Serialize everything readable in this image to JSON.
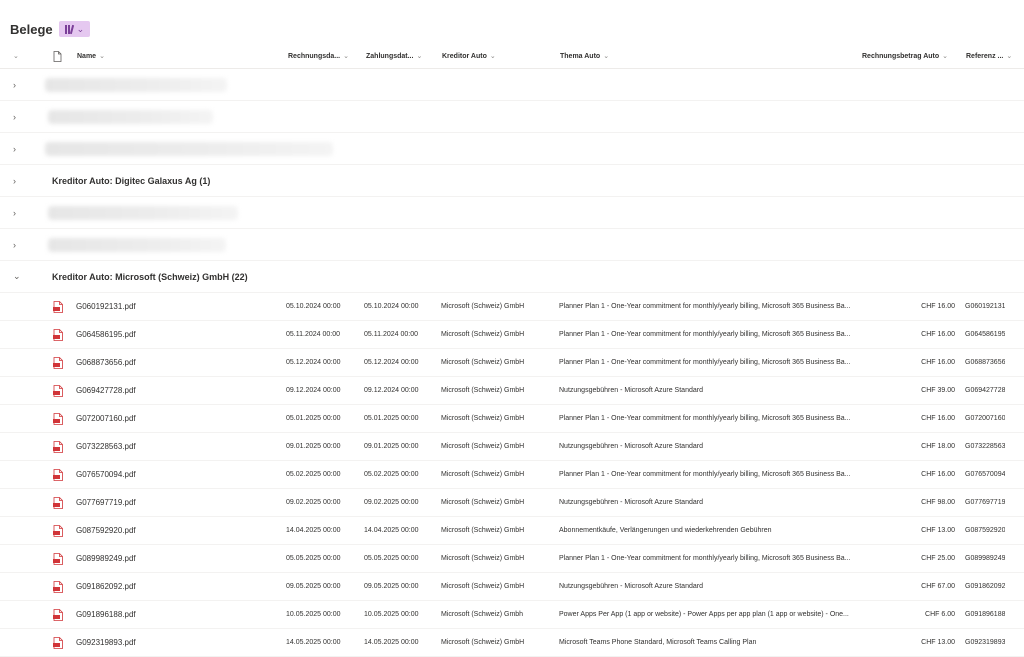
{
  "header": {
    "title": "Belege",
    "view_icon": "library-icon"
  },
  "columns": {
    "name": "Name",
    "rechnungsdatum": "Rechnungsda...",
    "zahlungsdatum": "Zahlungsdat...",
    "kreditor": "Kreditor Auto",
    "thema": "Thema Auto",
    "betrag": "Rechnungsbetrag Auto",
    "referenz": "Referenz ..."
  },
  "groups": {
    "digitec": "Kreditor Auto: Digitec Galaxus Ag (1)",
    "microsoft": "Kreditor Auto: Microsoft (Schweiz) GmbH (22)"
  },
  "files": [
    {
      "name": "G060192131.pdf",
      "rdate": "05.10.2024 00:00",
      "zdate": "05.10.2024 00:00",
      "kreditor": "Microsoft (Schweiz) GmbH",
      "thema": "Planner Plan 1 - One-Year commitment for monthly/yearly billing, Microsoft 365 Business Ba...",
      "betrag": "CHF 16.00",
      "ref": "G060192131"
    },
    {
      "name": "G064586195.pdf",
      "rdate": "05.11.2024 00:00",
      "zdate": "05.11.2024 00:00",
      "kreditor": "Microsoft (Schweiz) GmbH",
      "thema": "Planner Plan 1 - One-Year commitment for monthly/yearly billing, Microsoft 365 Business Ba...",
      "betrag": "CHF 16.00",
      "ref": "G064586195"
    },
    {
      "name": "G068873656.pdf",
      "rdate": "05.12.2024 00:00",
      "zdate": "05.12.2024 00:00",
      "kreditor": "Microsoft (Schweiz) GmbH",
      "thema": "Planner Plan 1 - One-Year commitment for monthly/yearly billing, Microsoft 365 Business Ba...",
      "betrag": "CHF 16.00",
      "ref": "G068873656"
    },
    {
      "name": "G069427728.pdf",
      "rdate": "09.12.2024 00:00",
      "zdate": "09.12.2024 00:00",
      "kreditor": "Microsoft (Schweiz) GmbH",
      "thema": "Nutzungsgebühren - Microsoft Azure Standard",
      "betrag": "CHF 39.00",
      "ref": "G069427728"
    },
    {
      "name": "G072007160.pdf",
      "rdate": "05.01.2025 00:00",
      "zdate": "05.01.2025 00:00",
      "kreditor": "Microsoft (Schweiz) GmbH",
      "thema": "Planner Plan 1 - One-Year commitment for monthly/yearly billing, Microsoft 365 Business Ba...",
      "betrag": "CHF 16.00",
      "ref": "G072007160"
    },
    {
      "name": "G073228563.pdf",
      "rdate": "09.01.2025 00:00",
      "zdate": "09.01.2025 00:00",
      "kreditor": "Microsoft (Schweiz) GmbH",
      "thema": "Nutzungsgebühren - Microsoft Azure Standard",
      "betrag": "CHF 18.00",
      "ref": "G073228563"
    },
    {
      "name": "G076570094.pdf",
      "rdate": "05.02.2025 00:00",
      "zdate": "05.02.2025 00:00",
      "kreditor": "Microsoft (Schweiz) GmbH",
      "thema": "Planner Plan 1 - One-Year commitment for monthly/yearly billing, Microsoft 365 Business Ba...",
      "betrag": "CHF 16.00",
      "ref": "G076570094"
    },
    {
      "name": "G077697719.pdf",
      "rdate": "09.02.2025 00:00",
      "zdate": "09.02.2025 00:00",
      "kreditor": "Microsoft (Schweiz) GmbH",
      "thema": "Nutzungsgebühren - Microsoft Azure Standard",
      "betrag": "CHF 98.00",
      "ref": "G077697719"
    },
    {
      "name": "G087592920.pdf",
      "rdate": "14.04.2025 00:00",
      "zdate": "14.04.2025 00:00",
      "kreditor": "Microsoft (Schweiz) GmbH",
      "thema": "Abonnementkäufe, Verlängerungen und wiederkehrenden Gebühren",
      "betrag": "CHF 13.00",
      "ref": "G087592920"
    },
    {
      "name": "G089989249.pdf",
      "rdate": "05.05.2025 00:00",
      "zdate": "05.05.2025 00:00",
      "kreditor": "Microsoft (Schweiz) GmbH",
      "thema": "Planner Plan 1 - One-Year commitment for monthly/yearly billing, Microsoft 365 Business Ba...",
      "betrag": "CHF 25.00",
      "ref": "G089989249"
    },
    {
      "name": "G091862092.pdf",
      "rdate": "09.05.2025 00:00",
      "zdate": "09.05.2025 00:00",
      "kreditor": "Microsoft (Schweiz) GmbH",
      "thema": "Nutzungsgebühren - Microsoft Azure Standard",
      "betrag": "CHF 67.00",
      "ref": "G091862092"
    },
    {
      "name": "G091896188.pdf",
      "rdate": "10.05.2025 00:00",
      "zdate": "10.05.2025 00:00",
      "kreditor": "Microsoft (Schweiz) Gmbh",
      "thema": "Power Apps Per App (1 app or website) - Power Apps per app plan (1 app or website) - One...",
      "betrag": "CHF 6.00",
      "ref": "G091896188"
    },
    {
      "name": "G092319893.pdf",
      "rdate": "14.05.2025 00:00",
      "zdate": "14.05.2025 00:00",
      "kreditor": "Microsoft (Schweiz) GmbH",
      "thema": "Microsoft Teams Phone Standard, Microsoft Teams Calling Plan",
      "betrag": "CHF 13.00",
      "ref": "G092319893"
    }
  ],
  "colors": {
    "accent": "#e5c8f0",
    "pdf_icon": "#d13438"
  }
}
